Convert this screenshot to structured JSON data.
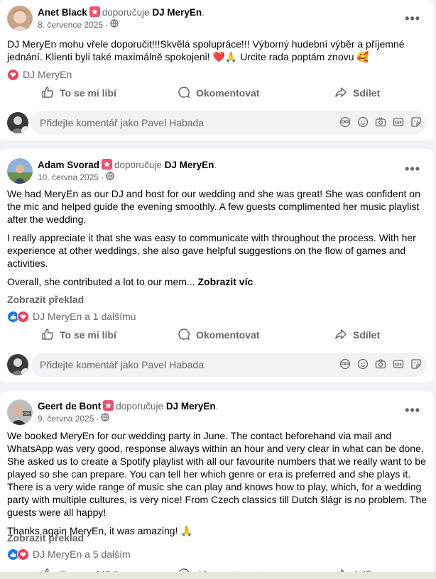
{
  "posts": [
    {
      "author": "Anet Black",
      "recommends": "doporučuje",
      "page": "DJ MeryEn",
      "date": "8. července 2025",
      "paragraphs": [
        "DJ MeryEn mohu vřele doporučit!!!Skvělá spolupráce!!! Výborný hudební výběr a příjemné jednání. Klienti byli také maximálně spokojeni! ❤️🙏 Urcite rada poptám znovu 🥰"
      ],
      "reaction_text": "DJ MeryEn",
      "like_label": "To se mi líbí",
      "comment_label": "Okomentovat",
      "share_label": "Sdílet",
      "comment_placeholder": "Přidejte komentář jako Pavel Habada"
    },
    {
      "author": "Adam Svorad",
      "recommends": "doporučuje",
      "page": "DJ MeryEn",
      "date": "10. června 2025",
      "paragraphs": [
        "We had MeryEn as our DJ and host for our wedding and she was great! She was confident on the mic and helped guide the evening smoothly. A few guests complimented her music playlist after the wedding.",
        "I really appreciate it that she was easy to communicate with throughout the process. With her experience at other weddings, she also gave helpful suggestions on the flow of games and activities.",
        "Overall, she contributed a lot to our mem..."
      ],
      "see_more": "Zobrazit víc",
      "translate": "Zobrazit překlad",
      "reaction_text": "DJ MeryEn a 1 dalšímu",
      "like_label": "To se mi líbí",
      "comment_label": "Okomentovat",
      "share_label": "Sdílet",
      "comment_placeholder": "Přidejte komentář jako Pavel Habada"
    },
    {
      "author": "Geert de Bont",
      "recommends": "doporučuje",
      "page": "DJ MeryEn",
      "date": "9. června 2025",
      "paragraphs": [
        "We booked MeryEn for our wedding party in June. The contact beforehand via mail and WhatsApp was very good, response always within an hour and very clear in what can be done. She asked us to create a Spotify playlist with all our favourite numbers that we really want to be played so she can prepare. You can tell her which genre or era is preferred and she plays it. There is a very wide range of music she can play and knows how to play, which, for a wedding party with multiple cultures, is very nice! From Czech classics till Dutch šlágr is no problem. The guests were all happy!",
        "Thanks again MeryEn, it was amazing! 🙏"
      ],
      "translate": "Zobrazit překlad",
      "reaction_text": "DJ MeryEn a 5 dalším",
      "like_label": "To se mi líbí",
      "comment_label": "Okomentovat",
      "share_label": "Sdílet"
    }
  ],
  "more_glyph": "•••",
  "colors": {
    "recommend_badge": "#f0506e",
    "like": "#1877f2",
    "love": "#f33e58"
  }
}
